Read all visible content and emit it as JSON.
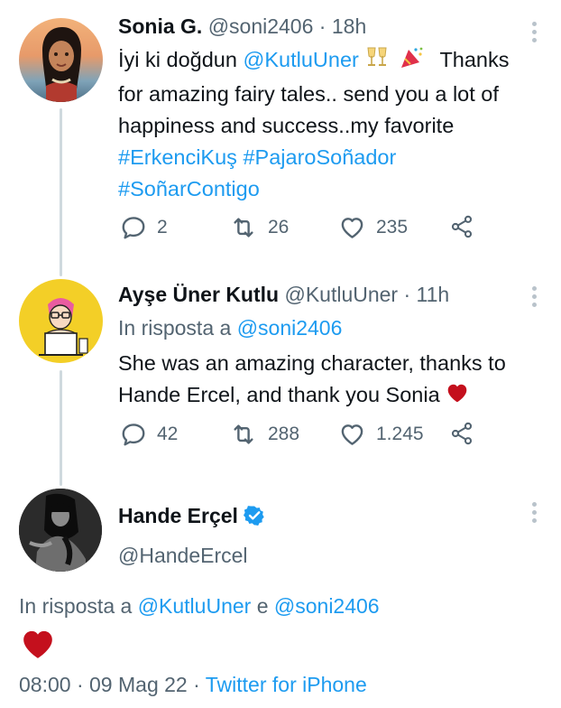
{
  "tweets": [
    {
      "name": "Sonia G.",
      "handle": "@soni2406",
      "sep": "·",
      "time": "18h",
      "text_1": "İyi ki doğdun",
      "mention": "@KutluUner",
      "text_2": "Thanks",
      "text_3": "for amazing fairy tales.. send you a lot of",
      "text_4": "happiness and success..my favorite",
      "tag_1": "#ErkenciKuş",
      "tag_2": "#PajaroSoñador",
      "tag_3": "#SoñarContigo",
      "replies": "2",
      "retweets": "26",
      "likes": "235"
    },
    {
      "name": "Ayşe Üner Kutlu",
      "handle": "@KutluUner",
      "sep": "·",
      "time": "11h",
      "reply_label": "In risposta a",
      "reply_to": "@soni2406",
      "text_1": "She was an amazing character, thanks to",
      "text_2": "Hande Ercel, and thank you Sonia",
      "replies": "42",
      "retweets": "288",
      "likes": "1.245"
    }
  ],
  "main_tweet": {
    "name": "Hande Erçel",
    "handle": "@HandeErcel",
    "reply_label": "In risposta a",
    "reply_to_1": "@KutluUner",
    "conj": "e",
    "reply_to_2": "@soni2406",
    "time": "08:00",
    "sep": "·",
    "date": "09 Mag 22",
    "source": "Twitter for iPhone"
  },
  "icons": {
    "reply": "reply-icon",
    "retweet": "retweet-icon",
    "like": "heart-icon",
    "share": "share-icon",
    "more": "more-vertical-icon",
    "verified": "verified-badge-icon",
    "heart_emoji": "red-heart-emoji",
    "party": "party-popper-emoji",
    "clink": "clinking-glasses-emoji"
  },
  "colors": {
    "link": "#1d9bf0",
    "muted": "#536471",
    "heart": "#c4101d"
  }
}
